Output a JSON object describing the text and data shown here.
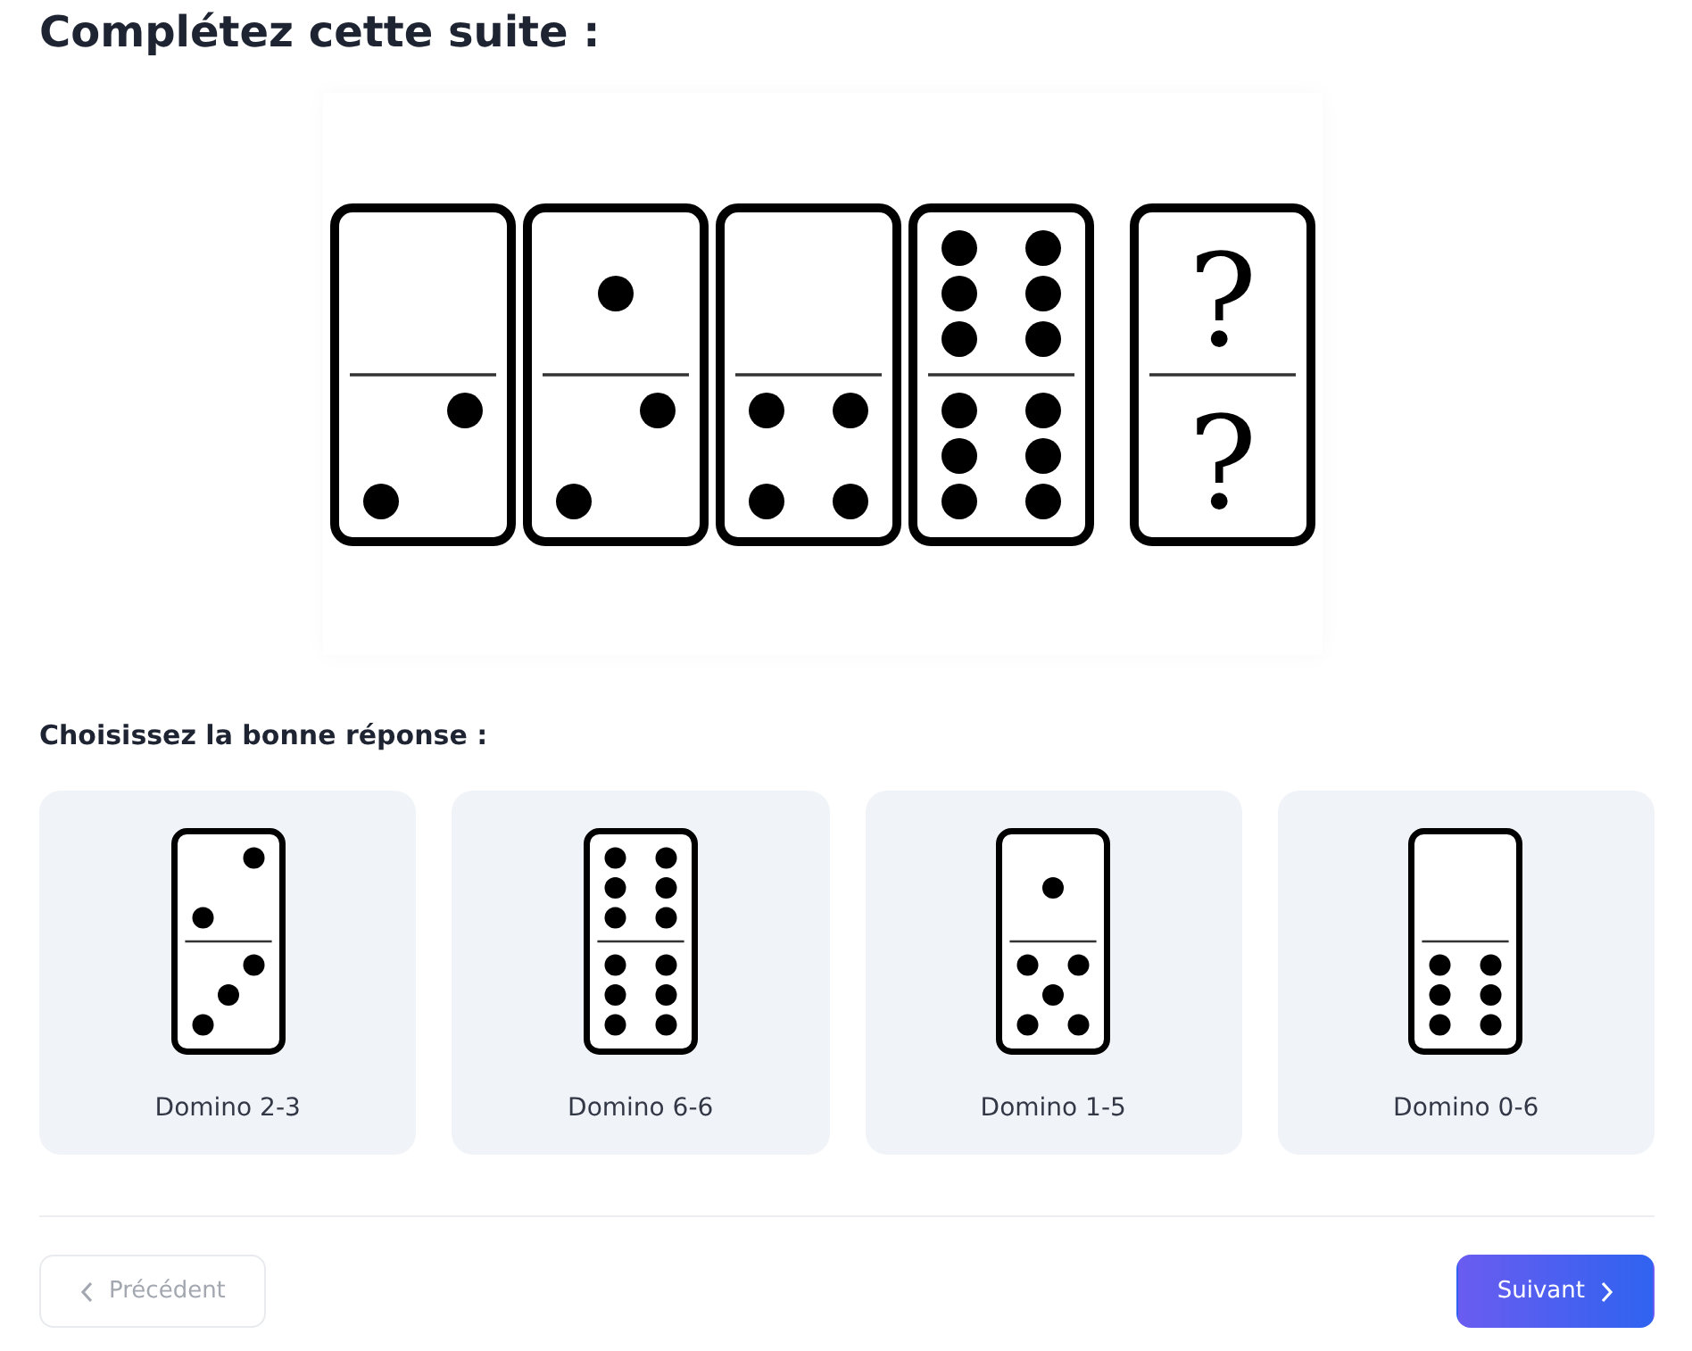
{
  "title": "Complétez cette suite :",
  "sequence": [
    {
      "kind": "pips",
      "faces": [
        {
          "kind": "blank"
        },
        {
          "kind": "two"
        }
      ]
    },
    {
      "kind": "pips",
      "faces": [
        {
          "kind": "one"
        },
        {
          "kind": "two"
        }
      ]
    },
    {
      "kind": "pips",
      "faces": [
        {
          "kind": "blank"
        },
        {
          "kind": "four"
        }
      ]
    },
    {
      "kind": "pips",
      "faces": [
        {
          "kind": "six"
        },
        {
          "kind": "six"
        }
      ]
    },
    {
      "kind": "question",
      "faces": [
        {
          "kind": "symbol",
          "text": "?"
        },
        {
          "kind": "symbol",
          "text": "?"
        }
      ]
    }
  ],
  "prompt": "Choisissez la bonne réponse :",
  "options": [
    {
      "label": "Domino 2-3",
      "faces": [
        {
          "kind": "two"
        },
        {
          "kind": "three"
        }
      ],
      "selected": false
    },
    {
      "label": "Domino 6-6",
      "faces": [
        {
          "kind": "six"
        },
        {
          "kind": "six"
        }
      ],
      "selected": false
    },
    {
      "label": "Domino 1-5",
      "faces": [
        {
          "kind": "one"
        },
        {
          "kind": "five"
        }
      ],
      "selected": false
    },
    {
      "label": "Domino 0-6",
      "faces": [
        {
          "kind": "blank"
        },
        {
          "kind": "six"
        }
      ],
      "selected": false
    }
  ],
  "buttons": {
    "previous": {
      "label": "Précédent",
      "disabled": true
    },
    "next": {
      "label": "Suivant",
      "disabled": false
    }
  }
}
